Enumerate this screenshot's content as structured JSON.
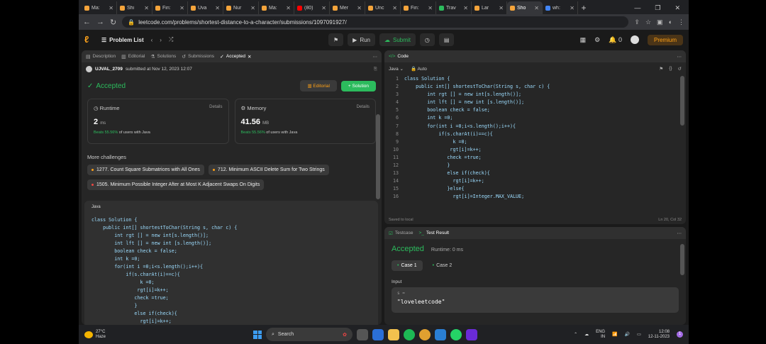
{
  "browser": {
    "tabs": [
      {
        "label": "Ma:",
        "color": "#f4a43b"
      },
      {
        "label": "Shi",
        "color": "#f4a43b"
      },
      {
        "label": "Fin:",
        "color": "#f4a43b"
      },
      {
        "label": "Uva",
        "color": "#f4a43b"
      },
      {
        "label": "Nur",
        "color": "#f4a43b"
      },
      {
        "label": "Ma:",
        "color": "#f4a43b"
      },
      {
        "label": "(80)",
        "color": "#ff0000"
      },
      {
        "label": "Mer",
        "color": "#f4a43b"
      },
      {
        "label": "Unc",
        "color": "#f4a43b"
      },
      {
        "label": "Fin:",
        "color": "#f4a43b"
      },
      {
        "label": "Trav",
        "color": "#2cbb5d"
      },
      {
        "label": "Lar",
        "color": "#f4a43b"
      },
      {
        "label": "Sho",
        "color": "#f4a43b"
      },
      {
        "label": "wh:",
        "color": "#4285f4"
      }
    ],
    "url": "leetcode.com/problems/shortest-distance-to-a-character/submissions/1097091927/"
  },
  "nav": {
    "problem_list": "Problem List",
    "run": "Run",
    "submit": "Submit",
    "coins": "0",
    "premium": "Premium"
  },
  "left": {
    "tabs": [
      "Description",
      "Editorial",
      "Solutions",
      "Submissions",
      "Accepted"
    ],
    "user": "UJVAL_2709",
    "submitted": "submitted at Nov 12, 2023 12:07",
    "status": "Accepted",
    "editorial_btn": "Editorial",
    "solution_btn": "+ Solution",
    "runtime": {
      "label": "Runtime",
      "details": "Details",
      "value": "2",
      "unit": "ms",
      "beats_pct": "Beats 55.56%",
      "beats_text": "of users with Java"
    },
    "memory": {
      "label": "Memory",
      "details": "Details",
      "value": "41.56",
      "unit": "MB",
      "beats_pct": "Beats 55.56%",
      "beats_text": "of users with Java"
    },
    "more_challenges": "More challenges",
    "challenges": [
      "1277. Count Square Submatrices with All Ones",
      "712. Minimum ASCII Delete Sum for Two Strings",
      "1505. Minimum Possible Integer After at Most K Adjacent Swaps On Digits"
    ],
    "code_lang": "Java",
    "code": "class Solution {\n    public int[] shortestToChar(String s, char c) {\n        int rgt [] = new int[s.length()];\n        int lft [] = new int [s.length()];\n        boolean check = false;\n        int k =0;\n        for(int i =0;i<s.length();i++){\n            if(s.charAt(i)==c){\n                 k =0;\n                rgt[i]=k++;\n               check =true;\n               }\n               else if(check){\n                 rgt[i]=k++;"
  },
  "editor": {
    "title": "Code",
    "lang": "Java",
    "mode": "Auto",
    "line_numbers": "1\n2\n3\n4\n5\n6\n7\n8\n9\n10\n11\n12\n13\n14\n15\n16",
    "code": "class Solution {\n    public int[] shortestToChar(String s, char c) {\n        int rgt [] = new int[s.length()];\n        int lft [] = new int [s.length()];\n        boolean check = false;\n        int k =0;\n        for(int i =0;i<s.length();i++){\n            if(s.charAt(i)==c){\n                 k =0;\n                rgt[i]=k++;\n               check =true;\n               }\n               else if(check){\n                 rgt[i]=k++;\n               }else{\n                 rgt[i]=Integer.MAX_VALUE;",
    "saved": "Saved to local",
    "cursor": "Ln 20, Col 32"
  },
  "result": {
    "tab_testcase": "Testcase",
    "tab_result": "Test Result",
    "status": "Accepted",
    "runtime": "Runtime: 0 ms",
    "cases": [
      "Case 1",
      "Case 2"
    ],
    "input_label": "Input",
    "input_key": "s =",
    "input_value": "\"loveleetcode\""
  },
  "taskbar": {
    "temp": "27°C",
    "weather": "Haze",
    "search": "Search",
    "lang": "ENG",
    "region": "IN",
    "time": "12:08",
    "date": "12-11-2023",
    "badge": "1"
  }
}
